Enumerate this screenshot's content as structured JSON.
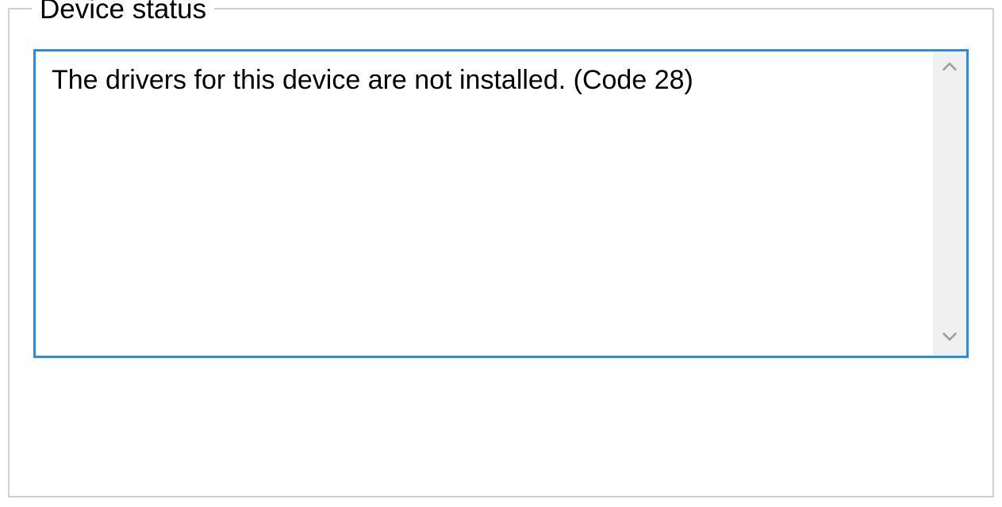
{
  "groupbox": {
    "legend": "Device status"
  },
  "status": {
    "message": "The drivers for this device are not installed. (Code 28)"
  }
}
